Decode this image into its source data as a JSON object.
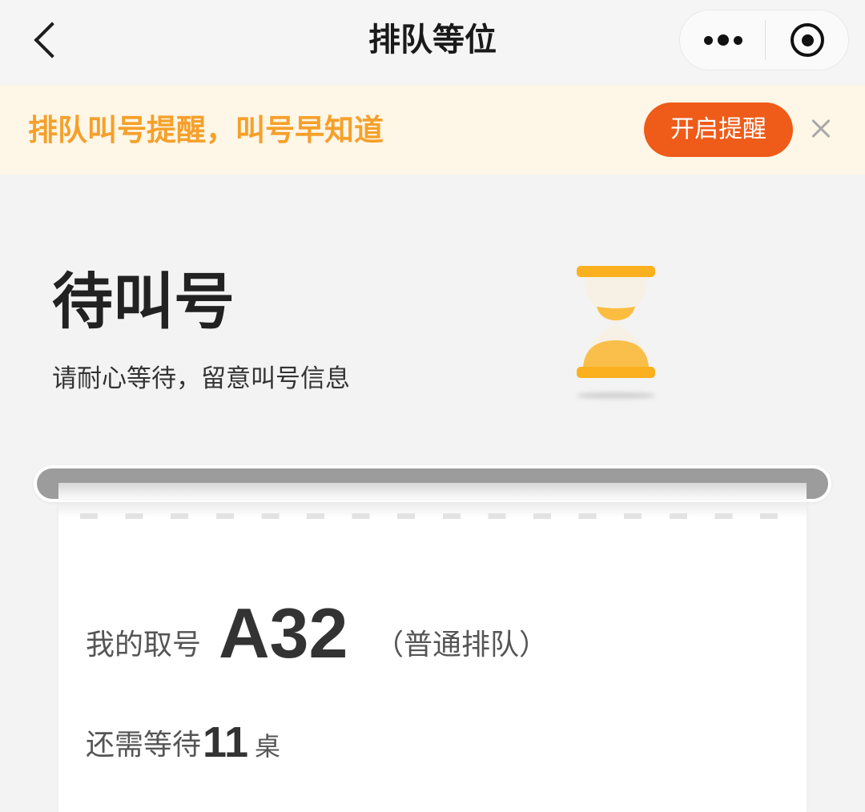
{
  "nav": {
    "title": "排队等位",
    "back_icon": "chevron-left-icon",
    "more_icon": "more-dots-icon",
    "capsule_close_icon": "target-circle-icon"
  },
  "banner": {
    "text": "排队叫号提醒，叫号早知道",
    "button_label": "开启提醒",
    "close_icon": "close-icon"
  },
  "status": {
    "title": "待叫号",
    "subtitle": "请耐心等待，留意叫号信息",
    "icon": "hourglass-icon"
  },
  "ticket": {
    "number_label": "我的取号",
    "number": "A32",
    "queue_type": "（普通排队）",
    "wait_label": "还需等待",
    "wait_count": "11",
    "wait_unit": "桌"
  },
  "colors": {
    "banner_bg": "#fef6e6",
    "banner_text": "#f5a02b",
    "button_bg": "#ef5b18",
    "hourglass": "#fbb11f",
    "text_primary": "#222222",
    "text_secondary": "#555555"
  }
}
